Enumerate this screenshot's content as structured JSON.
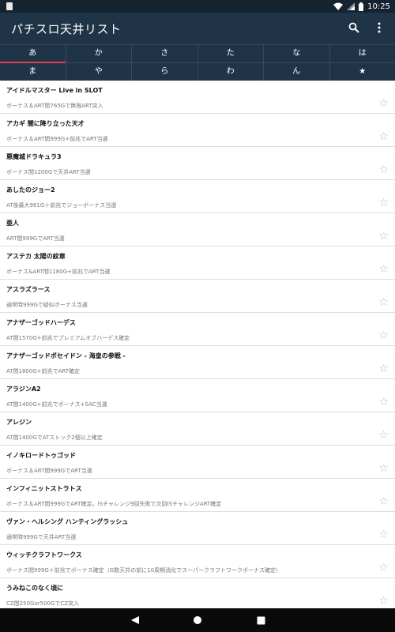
{
  "status_bar": {
    "time": "10:25"
  },
  "app_bar": {
    "title": "パチスロ天井リスト",
    "search_icon": "search-icon",
    "more_icon": "more-vert-icon"
  },
  "tabs": {
    "row1": [
      "あ",
      "か",
      "さ",
      "た",
      "な",
      "は"
    ],
    "row2": [
      "ま",
      "や",
      "ら",
      "わ",
      "ん",
      "★"
    ],
    "active": "あ",
    "accent_color": "#e04055"
  },
  "items": [
    {
      "title": "アイドルマスター Live in SLOT",
      "desc": "ボーナス＆ART間765Gで無限ART突入"
    },
    {
      "title": "アカギ 闇に降り立った天才",
      "desc": "ボーナス＆ART間999G+前兆でART当選"
    },
    {
      "title": "悪魔城ドラキュラ3",
      "desc": "ボーナス間1200Gで天井ART当選"
    },
    {
      "title": "あしたのジョー2",
      "desc": "AT後最大961G＋前兆でジョーボーナス当選"
    },
    {
      "title": "亜人",
      "desc": "ART間999GでART当選"
    },
    {
      "title": "アステカ 太陽の紋章",
      "desc": "ボーナス&ART間1180G+前兆でART当選"
    },
    {
      "title": "アスラズラース",
      "desc": "通常時999Gで疑似ボーナス当選"
    },
    {
      "title": "アナザーゴッドハーデス",
      "desc": "AT間1570G+前兆でプレミアムオブハーデス確定"
    },
    {
      "title": "アナザーゴッドポセイドン - 海皇の参戦 -",
      "desc": "AT間1800G+前兆でART確定"
    },
    {
      "title": "アラジンA2",
      "desc": "AT間1400G+前兆でボーナス+SAC当選"
    },
    {
      "title": "アレジン",
      "desc": "AT間1400GでATストック2個以上確定"
    },
    {
      "title": "イノキロードトゥゴッド",
      "desc": "ボーナス＆ART間999GでART当選"
    },
    {
      "title": "インフィニットストラトス",
      "desc": "ボーナス＆ART間999GでART確定。ISチャレンジ9回失敗で次回ISチャレンジART確定"
    },
    {
      "title": "ヴァン・ヘルシング ハンティングラッシュ",
      "desc": "通常時999Gで天井ART当選"
    },
    {
      "title": "ウィッチクラフトワークス",
      "desc": "ボーナス間999G＋前兆でボーナス確定（G数天井の前に10周期消化でスーパークラフトワークボーナス確定）"
    },
    {
      "title": "うみねこのなく頃に",
      "desc": "CZ間250Gor500GでCZ突入"
    }
  ]
}
